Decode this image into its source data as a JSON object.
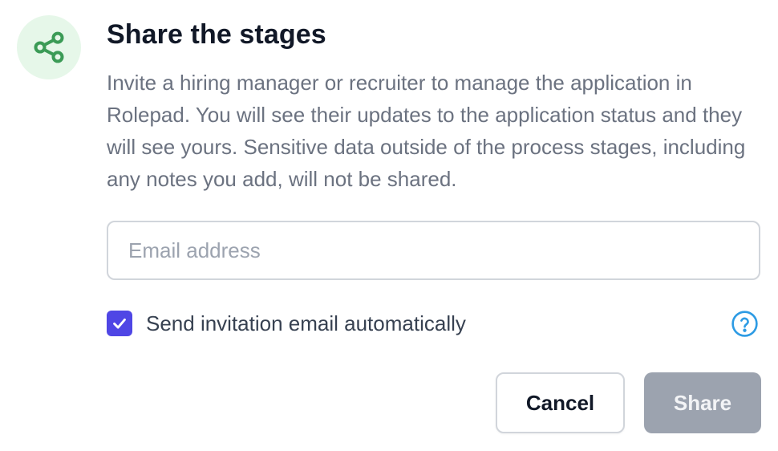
{
  "dialog": {
    "icon": "share-icon",
    "title": "Share the stages",
    "description": "Invite a hiring manager or recruiter to manage the application in Rolepad. You will see their updates to the application status and they will see yours. Sensitive data outside of the process stages, including any notes you add, will not be shared."
  },
  "email": {
    "value": "",
    "placeholder": "Email address"
  },
  "invitation": {
    "checked": true,
    "label": "Send invitation email automatically",
    "help_icon": "question-circle-icon"
  },
  "actions": {
    "cancel_label": "Cancel",
    "share_label": "Share",
    "share_disabled": true
  },
  "colors": {
    "icon_bg": "#e6f7e9",
    "icon_stroke": "#3b9b56",
    "checkbox": "#4f46e5",
    "help": "#2d9be4",
    "share_disabled_bg": "#9ca3af"
  }
}
